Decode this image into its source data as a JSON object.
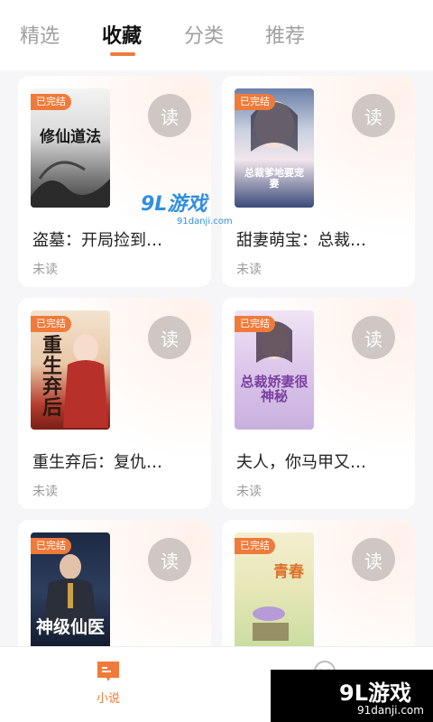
{
  "tabs": {
    "items": [
      "精选",
      "收藏",
      "分类",
      "推荐"
    ],
    "active_index": 1
  },
  "books": [
    {
      "title": "盗墓：开局捡到…",
      "status": "未读",
      "badge": "已完结",
      "read_label": "读",
      "cover_title": "修仙道法"
    },
    {
      "title": "甜妻萌宝：总裁…",
      "status": "未读",
      "badge": "已完结",
      "read_label": "读",
      "cover_title": "总裁爹地要宠妻"
    },
    {
      "title": "重生弃后：复仇…",
      "status": "未读",
      "badge": "已完结",
      "read_label": "读",
      "cover_title": "重生弃后"
    },
    {
      "title": "夫人，你马甲又…",
      "status": "未读",
      "badge": "已完结",
      "read_label": "读",
      "cover_title": "总裁娇妻很神秘"
    },
    {
      "title": "",
      "status": "",
      "badge": "已完结",
      "read_label": "读",
      "cover_title": "神级仙医"
    },
    {
      "title": "",
      "status": "",
      "badge": "已完结",
      "read_label": "读",
      "cover_title": "青春"
    }
  ],
  "bottom_nav": {
    "items": [
      {
        "label": "小说",
        "icon": "book-icon",
        "active": true
      },
      {
        "label": "",
        "icon": "chat-icon",
        "active": false
      }
    ]
  },
  "watermark": {
    "center_text": "9L游戏",
    "center_sub": "91danji.com",
    "corner_text": "9L游戏",
    "corner_sub": "91danji.com"
  },
  "colors": {
    "accent": "#f07a3a",
    "read_button": "#cfc7c3",
    "muted": "#9a9a9a"
  }
}
